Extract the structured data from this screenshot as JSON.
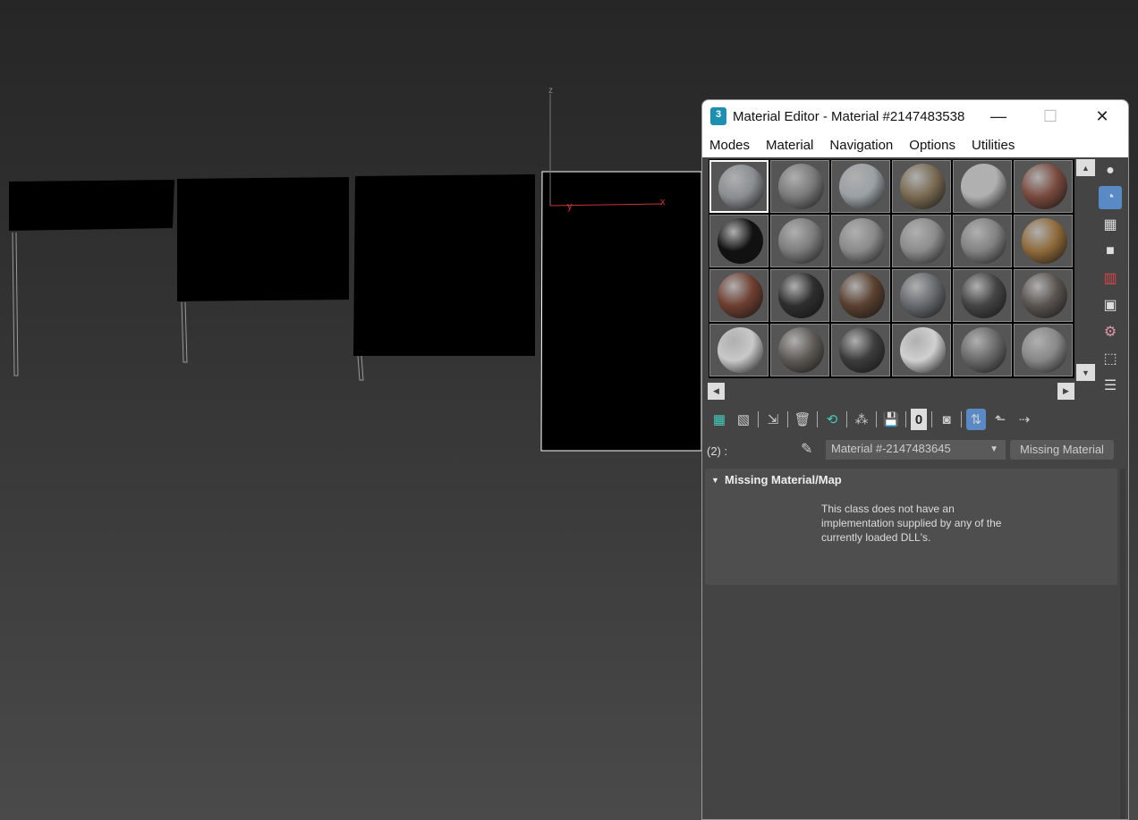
{
  "window": {
    "title": "Material Editor - Material #2147483538",
    "logo_text": "3",
    "minimize": "—",
    "maximize": "☐",
    "close": "✕"
  },
  "menu": [
    "Modes",
    "Material",
    "Navigation",
    "Options",
    "Utilities"
  ],
  "slots": [
    "#8a8e92",
    "#7a7a7a",
    "#9aa0a4",
    "#7a6a52",
    "#b0b0b0",
    "#7a4a3e",
    "#111111",
    "#7c7c7c",
    "#8a8a8a",
    "#8c8c8c",
    "#828282",
    "#8f6a3a",
    "#6e3e30",
    "#2e2e2e",
    "#5a4030",
    "#666a6e",
    "#444444",
    "#5a5450",
    "#c8c8c8",
    "#5f5a55",
    "#3c3c3c",
    "#d0d0d0",
    "#6a6a6a",
    "#888888"
  ],
  "selected_slot": 0,
  "viewport": {
    "axis_z": "z",
    "axis_x": "x",
    "axis_y": "y"
  },
  "toolbar": {
    "zero_label": "0"
  },
  "slot_label": "(2) :",
  "material_name": "Material #-2147483645",
  "material_type": "Missing Material",
  "rollout": {
    "title": "Missing Material/Map",
    "message": "This class does not have an implementation supplied by any of the currently loaded DLL's."
  }
}
